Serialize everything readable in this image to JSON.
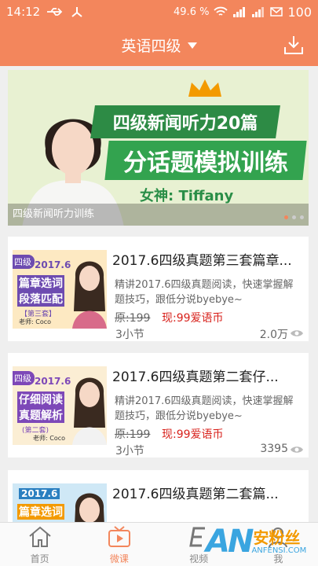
{
  "status": {
    "time": "14:12",
    "battery_pct": "49.6 %",
    "battery": "100"
  },
  "header": {
    "title": "英语四级"
  },
  "banner": {
    "title_line1": "四级新闻听力20篇",
    "title_line2": "分话题模拟训练",
    "teacher": "女神: Tiffany",
    "caption": "四级新闻听力训练",
    "dots": 3,
    "active_dot": 0
  },
  "courses": [
    {
      "title": "2017.6四级真题第三套篇章...",
      "desc": "精讲2017.6四级真题阅读，快速掌握解题技巧，跟低分说byebye~",
      "orig": "原:199",
      "now": "现:99爱语币",
      "lessons": "3小节",
      "views": "2.0万",
      "thumb_tag": "四级",
      "thumb_year": "2017.6",
      "thumb_l1": "篇章选词",
      "thumb_l2": "段落匹配",
      "thumb_set": "【第三套】",
      "thumb_teacher": "老师: Coco"
    },
    {
      "title": "2017.6四级真题第二套仔...",
      "desc": "精讲2017.6四级真题阅读，快速掌握解题技巧，跟低分说byebye~",
      "orig": "原:199",
      "now": "现:99爱语币",
      "lessons": "3小节",
      "views": "3395",
      "thumb_tag": "四级",
      "thumb_year": "2017.6",
      "thumb_l1": "仔细阅读",
      "thumb_l2": "真题解析",
      "thumb_set": "(第二套)",
      "thumb_teacher": "老师: Coco"
    },
    {
      "title": "2017.6四级真题第二套篇...",
      "thumb_year": "2017.6",
      "thumb_l1": "篇章选词"
    }
  ],
  "nav": [
    {
      "label": "首页",
      "icon": "home-icon"
    },
    {
      "label": "微课",
      "icon": "tv-play-icon"
    },
    {
      "label": "视频",
      "icon": "video-e-icon"
    },
    {
      "label": "我",
      "icon": "person-icon"
    }
  ],
  "watermark": {
    "an": "AN",
    "cn": "安粉丝",
    "en": "ANFENSI.COM"
  },
  "colors": {
    "accent": "#f3865c",
    "price": "#d8221c",
    "banner_green": "#33a34f"
  }
}
